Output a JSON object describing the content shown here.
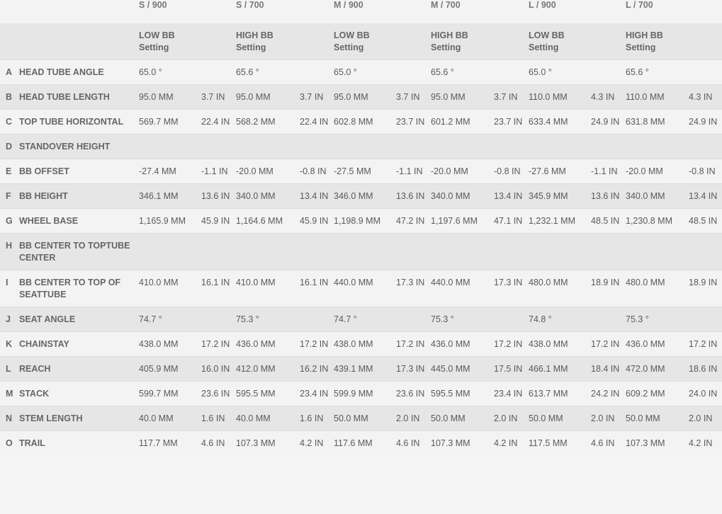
{
  "sizes": [
    "S / 900",
    "S / 700",
    "M / 900",
    "M / 700",
    "L / 900",
    "L / 700"
  ],
  "settings": [
    [
      "LOW BB",
      "Setting"
    ],
    [
      "HIGH BB",
      "Setting"
    ],
    [
      "LOW BB",
      "Setting"
    ],
    [
      "HIGH BB",
      "Setting"
    ],
    [
      "LOW BB",
      "Setting"
    ],
    [
      "HIGH BB",
      "Setting"
    ]
  ],
  "rows": [
    {
      "letter": "A",
      "label": "HEAD TUBE ANGLE",
      "cells": [
        [
          "65.0 °",
          ""
        ],
        [
          "65.6 °",
          ""
        ],
        [
          "65.0 °",
          ""
        ],
        [
          "65.6 °",
          ""
        ],
        [
          "65.0 °",
          ""
        ],
        [
          "65.6 °",
          ""
        ]
      ]
    },
    {
      "letter": "B",
      "label": "HEAD TUBE LENGTH",
      "cells": [
        [
          "95.0 MM",
          "3.7 IN"
        ],
        [
          "95.0 MM",
          "3.7 IN"
        ],
        [
          "95.0 MM",
          "3.7 IN"
        ],
        [
          "95.0 MM",
          "3.7 IN"
        ],
        [
          "110.0 MM",
          "4.3 IN"
        ],
        [
          "110.0 MM",
          "4.3 IN"
        ]
      ]
    },
    {
      "letter": "C",
      "label": "TOP TUBE HORIZONTAL",
      "cells": [
        [
          "569.7 MM",
          "22.4 IN"
        ],
        [
          "568.2 MM",
          "22.4 IN"
        ],
        [
          "602.8 MM",
          "23.7 IN"
        ],
        [
          "601.2 MM",
          "23.7 IN"
        ],
        [
          "633.4 MM",
          "24.9 IN"
        ],
        [
          "631.8 MM",
          "24.9 IN"
        ]
      ]
    },
    {
      "letter": "D",
      "label": "STANDOVER HEIGHT",
      "cells": [
        [
          "",
          ""
        ],
        [
          "",
          ""
        ],
        [
          "",
          ""
        ],
        [
          "",
          ""
        ],
        [
          "",
          ""
        ],
        [
          "",
          ""
        ]
      ]
    },
    {
      "letter": "E",
      "label": "BB OFFSET",
      "cells": [
        [
          "-27.4 MM",
          "-1.1 IN"
        ],
        [
          "-20.0 MM",
          "-0.8 IN"
        ],
        [
          "-27.5 MM",
          "-1.1 IN"
        ],
        [
          "-20.0 MM",
          "-0.8 IN"
        ],
        [
          "-27.6 MM",
          "-1.1 IN"
        ],
        [
          "-20.0 MM",
          "-0.8 IN"
        ]
      ]
    },
    {
      "letter": "F",
      "label": "BB HEIGHT",
      "cells": [
        [
          "346.1 MM",
          "13.6 IN"
        ],
        [
          "340.0 MM",
          "13.4 IN"
        ],
        [
          "346.0 MM",
          "13.6 IN"
        ],
        [
          "340.0 MM",
          "13.4 IN"
        ],
        [
          "345.9 MM",
          "13.6 IN"
        ],
        [
          "340.0 MM",
          "13.4 IN"
        ]
      ]
    },
    {
      "letter": "G",
      "label": "WHEEL BASE",
      "cells": [
        [
          "1,165.9 MM",
          "45.9 IN"
        ],
        [
          "1,164.6 MM",
          "45.9 IN"
        ],
        [
          "1,198.9 MM",
          "47.2 IN"
        ],
        [
          "1,197.6 MM",
          "47.1 IN"
        ],
        [
          "1,232.1 MM",
          "48.5 IN"
        ],
        [
          "1,230.8 MM",
          "48.5 IN"
        ]
      ]
    },
    {
      "letter": "H",
      "label": "BB CENTER TO TOPTUBE CENTER",
      "cells": [
        [
          "",
          ""
        ],
        [
          "",
          ""
        ],
        [
          "",
          ""
        ],
        [
          "",
          ""
        ],
        [
          "",
          ""
        ],
        [
          "",
          ""
        ]
      ]
    },
    {
      "letter": "I",
      "label": "BB CENTER TO TOP OF SEATTUBE",
      "cells": [
        [
          "410.0 MM",
          "16.1 IN"
        ],
        [
          "410.0 MM",
          "16.1 IN"
        ],
        [
          "440.0 MM",
          "17.3 IN"
        ],
        [
          "440.0 MM",
          "17.3 IN"
        ],
        [
          "480.0 MM",
          "18.9 IN"
        ],
        [
          "480.0 MM",
          "18.9 IN"
        ]
      ]
    },
    {
      "letter": "J",
      "label": "SEAT ANGLE",
      "cells": [
        [
          "74.7 °",
          ""
        ],
        [
          "75.3 °",
          ""
        ],
        [
          "74.7 °",
          ""
        ],
        [
          "75.3 °",
          ""
        ],
        [
          "74.8 °",
          ""
        ],
        [
          "75.3 °",
          ""
        ]
      ]
    },
    {
      "letter": "K",
      "label": "CHAINSTAY",
      "cells": [
        [
          "438.0 MM",
          "17.2 IN"
        ],
        [
          "436.0 MM",
          "17.2 IN"
        ],
        [
          "438.0 MM",
          "17.2 IN"
        ],
        [
          "436.0 MM",
          "17.2 IN"
        ],
        [
          "438.0 MM",
          "17.2 IN"
        ],
        [
          "436.0 MM",
          "17.2 IN"
        ]
      ]
    },
    {
      "letter": "L",
      "label": "REACH",
      "cells": [
        [
          "405.9 MM",
          "16.0 IN"
        ],
        [
          "412.0 MM",
          "16.2 IN"
        ],
        [
          "439.1 MM",
          "17.3 IN"
        ],
        [
          "445.0 MM",
          "17.5 IN"
        ],
        [
          "466.1 MM",
          "18.4 IN"
        ],
        [
          "472.0 MM",
          "18.6 IN"
        ]
      ]
    },
    {
      "letter": "M",
      "label": "STACK",
      "cells": [
        [
          "599.7 MM",
          "23.6 IN"
        ],
        [
          "595.5 MM",
          "23.4 IN"
        ],
        [
          "599.9 MM",
          "23.6 IN"
        ],
        [
          "595.5 MM",
          "23.4 IN"
        ],
        [
          "613.7 MM",
          "24.2 IN"
        ],
        [
          "609.2 MM",
          "24.0 IN"
        ]
      ]
    },
    {
      "letter": "N",
      "label": "STEM LENGTH",
      "cells": [
        [
          "40.0 MM",
          "1.6 IN"
        ],
        [
          "40.0 MM",
          "1.6 IN"
        ],
        [
          "50.0 MM",
          "2.0 IN"
        ],
        [
          "50.0 MM",
          "2.0 IN"
        ],
        [
          "50.0 MM",
          "2.0 IN"
        ],
        [
          "50.0 MM",
          "2.0 IN"
        ]
      ]
    },
    {
      "letter": "O",
      "label": "TRAIL",
      "cells": [
        [
          "117.7 MM",
          "4.6 IN"
        ],
        [
          "107.3 MM",
          "4.2 IN"
        ],
        [
          "117.6 MM",
          "4.6 IN"
        ],
        [
          "107.3 MM",
          "4.2 IN"
        ],
        [
          "117.5 MM",
          "4.6 IN"
        ],
        [
          "107.3 MM",
          "4.2 IN"
        ]
      ]
    }
  ]
}
